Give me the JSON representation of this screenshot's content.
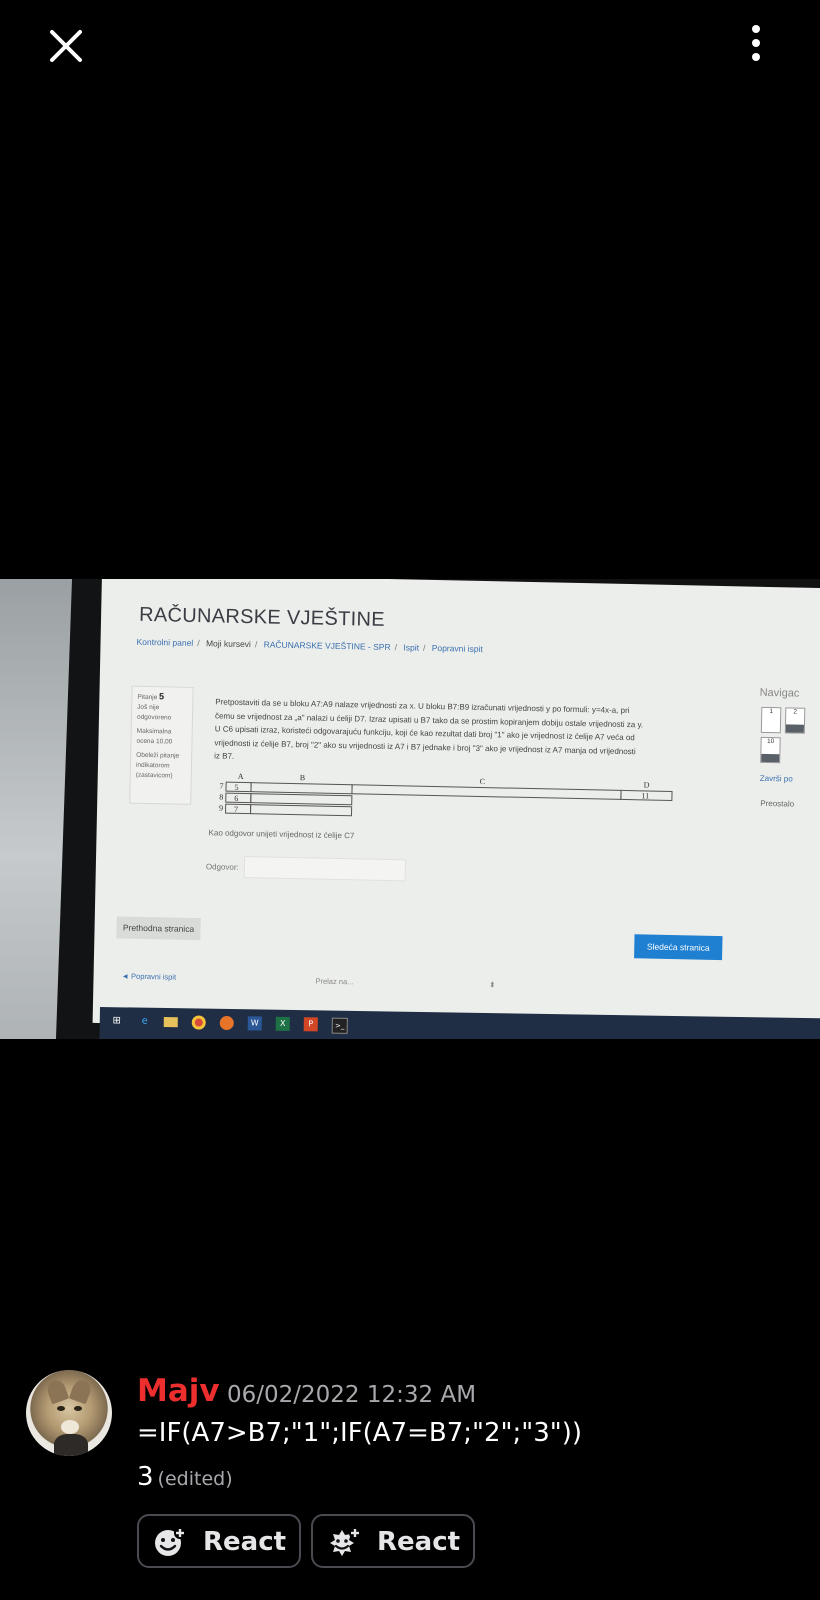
{
  "viewer": {
    "close_icon": "close-icon",
    "more_icon": "more-vertical-icon"
  },
  "photo": {
    "course_title": "RAČUNARSKE VJEŠTINE",
    "breadcrumbs": [
      "Kontrolni panel",
      "Moji kursevi",
      "RAČUNARSKE VJEŠTINE - SPR",
      "Ispit",
      "Popravni ispit"
    ],
    "question_info": {
      "label": "Pitanje",
      "number": "5",
      "status": "Još nije odgovoreno",
      "points": "Maksimalna ocena 10,00",
      "flag": "Obeleži pitanje indikatorom (zastavicom)"
    },
    "question_text": [
      "Pretpostaviti da se u bloku A7:A9 nalaze vrijednosti za x. U bloku B7:B9 izračunati vrijednosti y po formuli: y=4x-a, pri",
      "čemu se vrijednost za „a\" nalazi u ćeliji D7. Izraz upisati u B7 tako da se prostim kopiranjem dobiju ostale vrijednosti za y.",
      "U C6 upisati izraz, koristeći odgovarajuću funkciju, koji će kao rezultat dati broj \"1\" ako je vrijednost iz ćelije A7 veća od",
      "vrijednosti iz ćelije B7, broj \"2\" ako su vrijednosti iz A7 i B7 jednake i broj \"3\" ako je vrijednost iz A7 manja od vrijednosti",
      "iz B7."
    ],
    "sheet": {
      "columns": [
        "A",
        "B",
        "C",
        "D"
      ],
      "rows": [
        {
          "row": "7",
          "a": "5",
          "d": "11"
        },
        {
          "row": "8",
          "a": "6"
        },
        {
          "row": "9",
          "a": "7"
        }
      ]
    },
    "answer_hint": "Kao odgovor unijeti vrijednost iz ćelije C7",
    "answer_label": "Odgovor:",
    "prev_button": "Prethodna stranica",
    "next_button": "Sledeća stranica",
    "back_link": "◄ Popravni ispit",
    "jump_select": "Prelaz na...",
    "nav": {
      "title": "Navigac",
      "boxes": [
        "1",
        "2",
        "10"
      ],
      "finish_link": "Završi po",
      "remaining": "Preostalo"
    }
  },
  "message": {
    "username": "Majv",
    "username_color": "#ed2e2e",
    "timestamp": "06/02/2022 12:32 AM",
    "line1": "=IF(A7>B7;\"1\";IF(A7=B7;\"2\";\"3\"))",
    "line2": "3",
    "edited": "(edited)",
    "react_buttons": [
      {
        "label": "React",
        "icon": "add-emoji-icon"
      },
      {
        "label": "React",
        "icon": "add-super-reaction-icon"
      }
    ]
  }
}
